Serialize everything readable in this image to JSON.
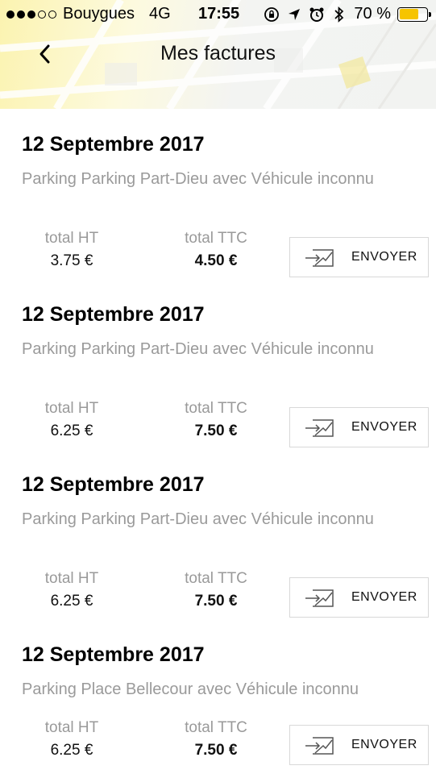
{
  "status_bar": {
    "carrier": "Bouygues",
    "network": "4G",
    "time": "17:55",
    "battery": "70 %",
    "battery_level": 0.7,
    "battery_color": "#f6c400"
  },
  "navbar": {
    "back_icon": "chevron-left-icon",
    "title": "Mes factures"
  },
  "labels": {
    "total_ht": "total HT",
    "total_ttc": "total TTC",
    "send": "ENVOYER",
    "send_icon": "send-mail-icon"
  },
  "invoices": [
    {
      "date": "12 Septembre 2017",
      "description": "Parking Parking Part-Dieu avec Véhicule inconnu",
      "total_ht": "3.75 €",
      "total_ttc": "4.50 €"
    },
    {
      "date": "12 Septembre 2017",
      "description": "Parking Parking Part-Dieu avec Véhicule inconnu",
      "total_ht": "6.25 €",
      "total_ttc": "7.50 €"
    },
    {
      "date": "12 Septembre 2017",
      "description": "Parking Parking Part-Dieu avec Véhicule inconnu",
      "total_ht": "6.25 €",
      "total_ttc": "7.50 €"
    },
    {
      "date": "12 Septembre 2017",
      "description": "Parking Place Bellecour avec Véhicule inconnu",
      "total_ht": "6.25 €",
      "total_ttc": "7.50 €"
    }
  ],
  "colors": {
    "accent_yellow": "#fbf3b0",
    "secondary_text": "#9a9a9a",
    "button_border": "#d8d8d8"
  }
}
